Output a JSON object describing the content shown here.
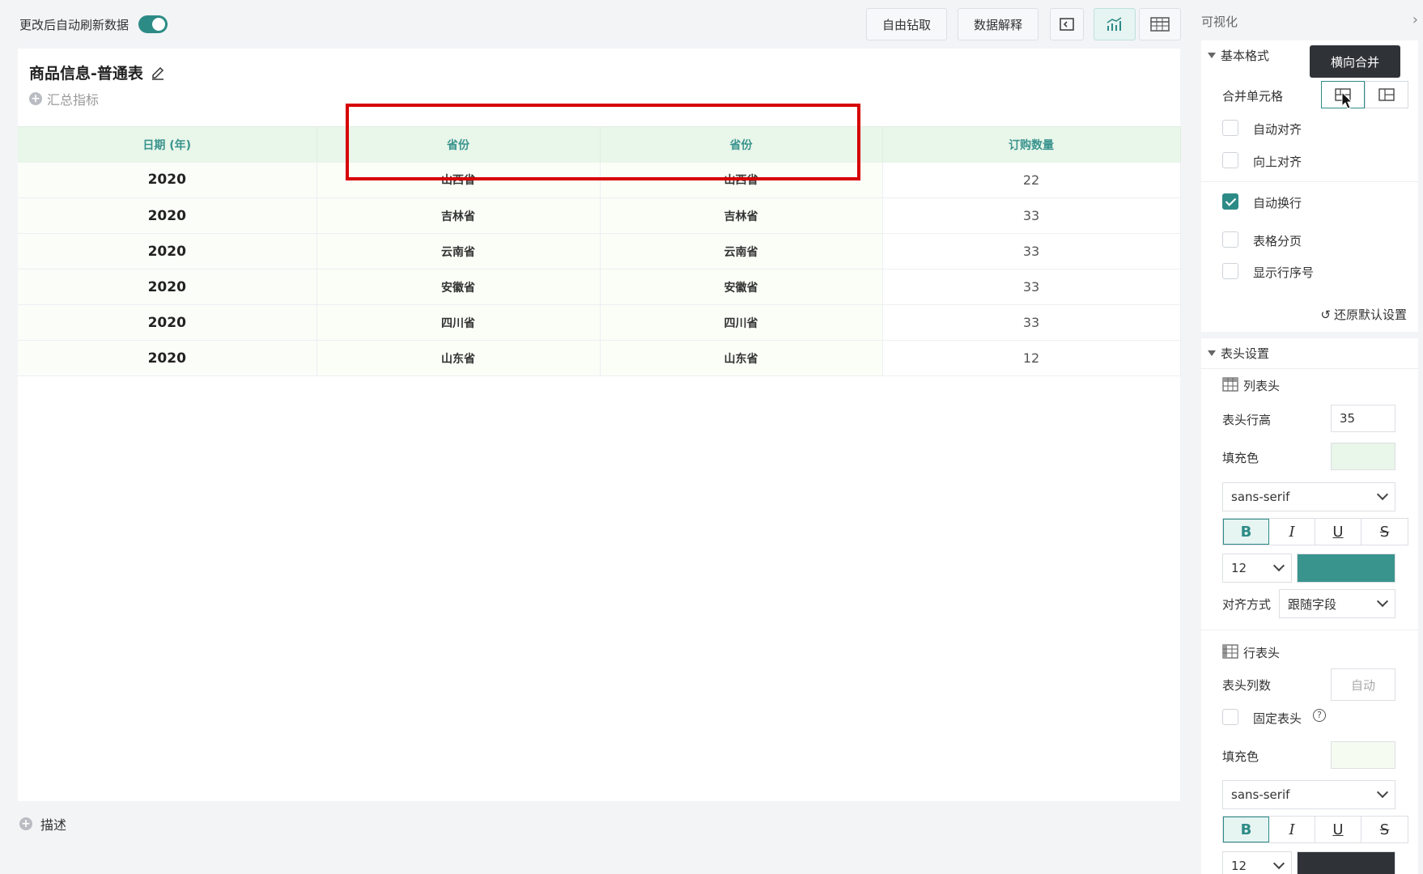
{
  "toolbar": {
    "auto_refresh_label": "更改后自动刷新数据",
    "drill_label": "自由钻取",
    "explain_label": "数据解释"
  },
  "card": {
    "title": "商品信息-普通表",
    "summary_label": "汇总指标",
    "describe_label": "描述"
  },
  "table": {
    "headers": [
      "日期 (年)",
      "省份",
      "省份",
      "订购数量"
    ],
    "rows": [
      [
        "2020",
        "山西省",
        "山西省",
        "22"
      ],
      [
        "2020",
        "吉林省",
        "吉林省",
        "33"
      ],
      [
        "2020",
        "云南省",
        "云南省",
        "33"
      ],
      [
        "2020",
        "安徽省",
        "安徽省",
        "33"
      ],
      [
        "2020",
        "四川省",
        "四川省",
        "33"
      ],
      [
        "2020",
        "山东省",
        "山东省",
        "12"
      ]
    ]
  },
  "panel": {
    "title": "可视化",
    "basic": {
      "heading": "基本格式",
      "merge_label": "合并单元格",
      "tooltip": "横向合并",
      "options": [
        {
          "label": "自动对齐",
          "checked": false
        },
        {
          "label": "向上对齐",
          "checked": false
        },
        {
          "label": "自动换行",
          "checked": true
        },
        {
          "label": "表格分页",
          "checked": false
        },
        {
          "label": "显示行序号",
          "checked": false
        }
      ],
      "restore_label": "还原默认设置"
    },
    "header": {
      "heading": "表头设置",
      "col_header_label": "列表头",
      "row_height_label": "表头行高",
      "row_height_value": "35",
      "fill_label": "填充色",
      "fill_color": "#e9f6ea",
      "font": "sans-serif",
      "bold": "B",
      "italic": "I",
      "underline": "U",
      "strike": "S",
      "font_size": "12",
      "font_color": "#3a948e",
      "align_label": "对齐方式",
      "align_value": "跟随字段",
      "row_header_label": "行表头",
      "col_count_label": "表头列数",
      "col_count_placeholder": "自动",
      "fix_header_label": "固定表头",
      "fill_label2": "填充色",
      "fill_color2": "#f6fbf2",
      "font2": "sans-serif",
      "font_size2": "12",
      "font_color2": "#2f3338"
    }
  }
}
